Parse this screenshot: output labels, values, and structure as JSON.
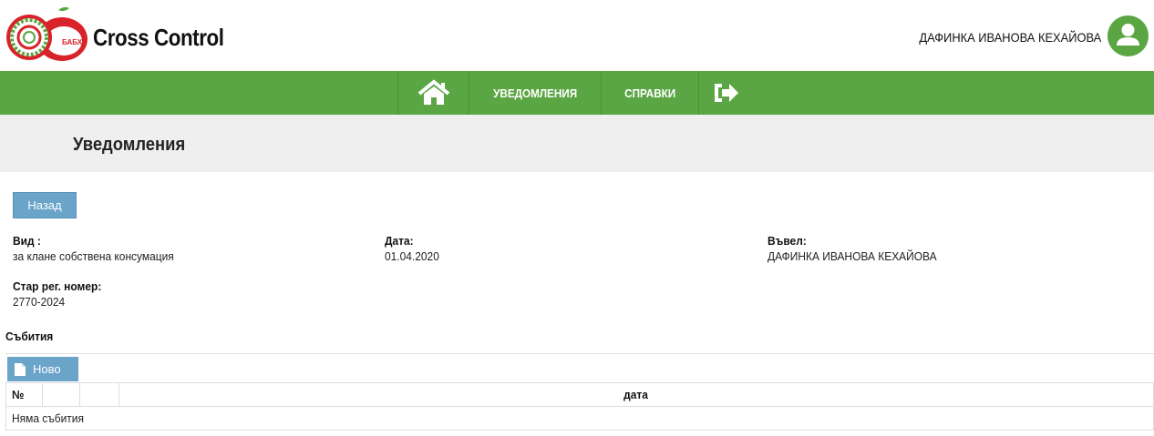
{
  "header": {
    "app_title": "Cross Control",
    "logo_text": "БАБХ",
    "user_name": "ДАФИНКА ИВАНОВА КЕХАЙОВА",
    "brand_green": "#5ba644",
    "brand_red": "#d8232a"
  },
  "nav": {
    "home_icon": "home-icon",
    "notifications_label": "УВЕДОМЛЕНИЯ",
    "reports_label": "СПРАВКИ",
    "logout_icon": "sign-out-icon"
  },
  "page": {
    "title": "Уведомления",
    "back_label": "Назад"
  },
  "details": {
    "type_label": "Вид :",
    "type_value": "за клане собствена консумация",
    "date_label": "Дата:",
    "date_value": "01.04.2020",
    "entered_by_label": "Въвел:",
    "entered_by_value": "ДАФИНКА ИВАНОВА КЕХАЙОВА",
    "old_reg_label": "Стар рег. номер:",
    "old_reg_value": "2770-2024"
  },
  "events": {
    "heading": "Събития",
    "new_label": "Ново",
    "columns": [
      "№",
      "",
      "",
      "дата"
    ],
    "empty_text": "Няма събития"
  }
}
